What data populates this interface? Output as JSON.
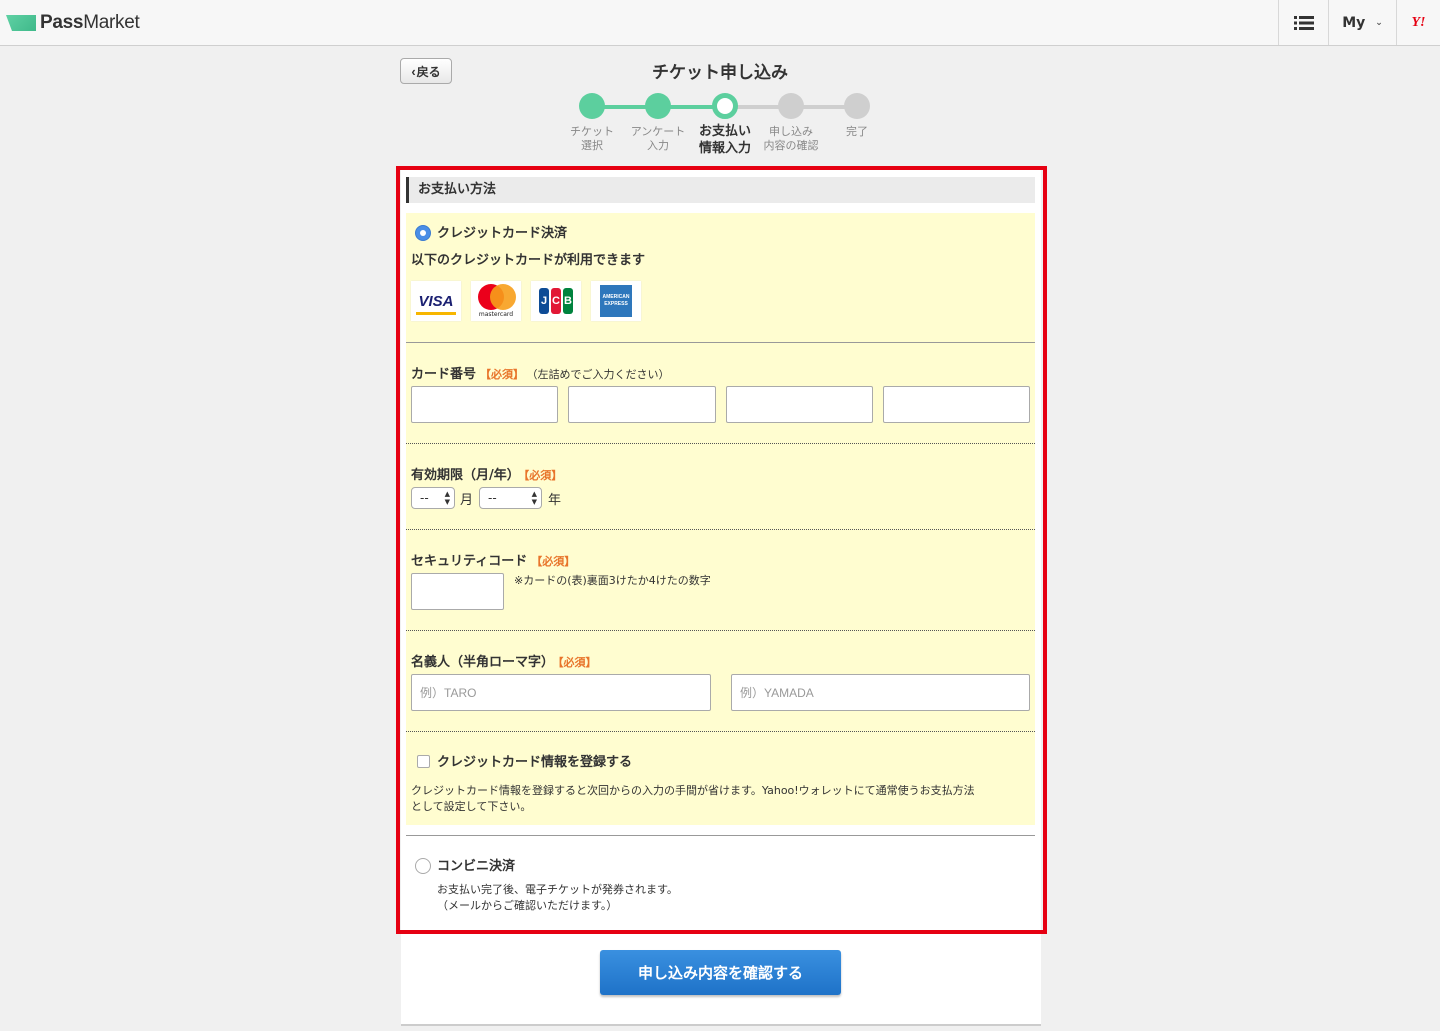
{
  "header": {
    "logo_pass": "Pass",
    "logo_market": "Market",
    "my_label": "My",
    "yahoo_label": "Y!"
  },
  "page": {
    "back_label": "戻る",
    "title": "チケット申し込み"
  },
  "steps": [
    {
      "line1": "チケット",
      "line2": "選択",
      "state": "done"
    },
    {
      "line1": "アンケート",
      "line2": "入力",
      "state": "done"
    },
    {
      "line1": "お支払い",
      "line2": "情報入力",
      "state": "current"
    },
    {
      "line1": "申し込み",
      "line2": "内容の確認",
      "state": "todo"
    },
    {
      "line1": "完了",
      "line2": "",
      "state": "todo"
    }
  ],
  "payment": {
    "section_title": "お支払い方法",
    "credit": {
      "label": "クレジットカード決済",
      "available_text": "以下のクレジットカードが利用できます",
      "brands": [
        "VISA",
        "mastercard",
        "JCB",
        "AMERICAN EXPRESS"
      ],
      "selected": true
    },
    "card_number": {
      "label": "カード番号",
      "required": "【必須】",
      "note": "（左詰めでご入力ください）",
      "values": [
        "",
        "",
        "",
        ""
      ]
    },
    "expiry": {
      "label": "有効期限（月/年）",
      "required": "【必須】",
      "month_value": "--",
      "month_unit": "月",
      "year_value": "--",
      "year_unit": "年"
    },
    "security_code": {
      "label": "セキュリティコード",
      "required": "【必須】",
      "hint": "※カードの(表)裏面3けたか4けたの数字",
      "value": ""
    },
    "holder_name": {
      "label": "名義人（半角ローマ字）",
      "required": "【必須】",
      "first_placeholder": "例）TARO",
      "last_placeholder": "例）YAMADA"
    },
    "register": {
      "label": "クレジットカード情報を登録する",
      "description_line1": "クレジットカード情報を登録すると次回からの入力の手間が省けます。Yahoo!ウォレットにて通常使うお支払方法",
      "description_line2": "として設定して下さい。",
      "checked": false
    },
    "convenience": {
      "label": "コンビニ決済",
      "note_line1": "お支払い完了後、電子チケットが発券されます。",
      "note_line2": "（メールからご確認いただけます。）",
      "selected": false
    }
  },
  "submit_label": "申し込み内容を確認する",
  "colors": {
    "accent_green": "#5ccf9e",
    "highlight_red": "#e60012",
    "required_orange": "#e8742a",
    "button_blue": "#1e72c8",
    "form_yellow": "#fffdd0"
  }
}
